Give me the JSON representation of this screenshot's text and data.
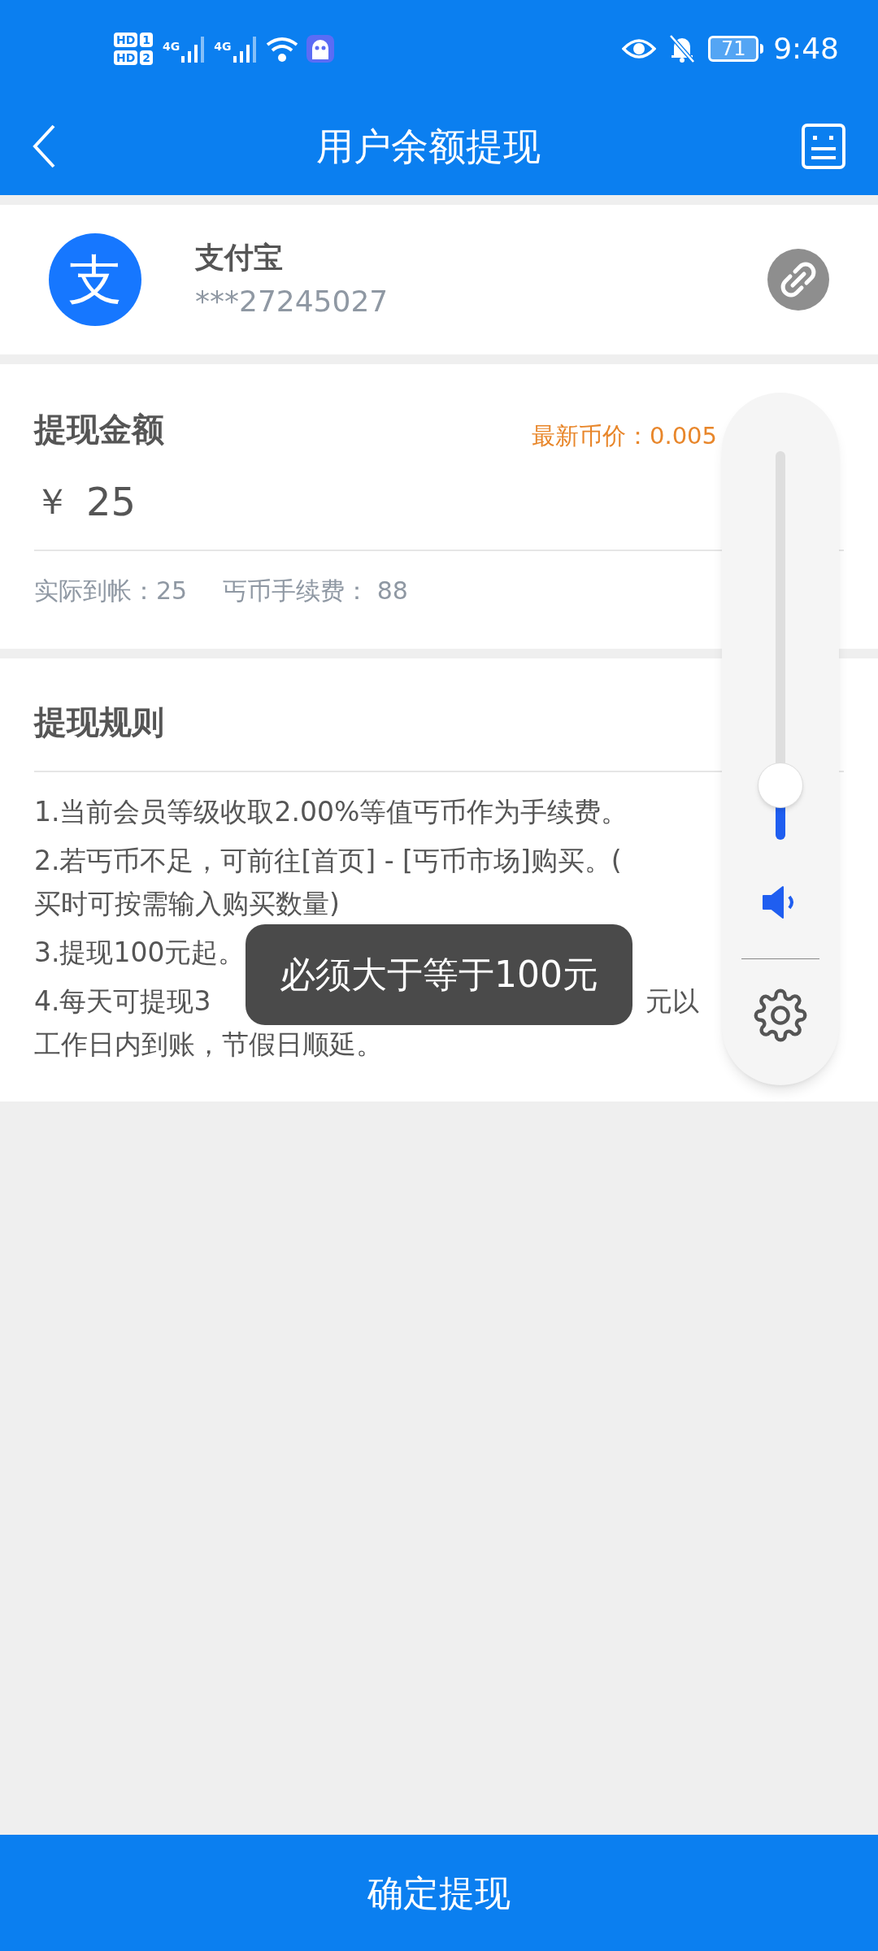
{
  "status_bar": {
    "sim_labels": [
      {
        "hd": "HD",
        "slot": "1"
      },
      {
        "hd": "HD",
        "slot": "2"
      }
    ],
    "network_labels": [
      "4G",
      "4G"
    ],
    "battery": "71",
    "time": "9:48"
  },
  "header": {
    "title": "用户余额提现"
  },
  "account": {
    "name": "支付宝",
    "logo_char": "支",
    "number": "***27245027"
  },
  "amount": {
    "title": "提现金额",
    "price": "最新币价：0.005",
    "currency": "￥",
    "value": "25",
    "received_label": "实际到帐：",
    "received": "25",
    "fee_label": "丐币手续费：",
    "fee": "88"
  },
  "rules": {
    "title": "提现规则",
    "items": [
      [
        [
          "1.当前会员等级收取2.00%等值丐币作为手续费。"
        ]
      ],
      [
        [
          "2.若丐币不足，可前往[首页] - [丐币市场]购买。("
        ],
        [
          "买时可按需输入购买数量)"
        ]
      ],
      [
        [
          "3.提现100元起。"
        ]
      ],
      [
        [
          "4.每天可提现3",
          "元以"
        ],
        [
          "工作日内到账，节假日顺延。"
        ]
      ]
    ]
  },
  "toast": "必须大于等于100元",
  "volume_panel": {
    "level": 0.14
  },
  "submit_button": "确定提现"
}
